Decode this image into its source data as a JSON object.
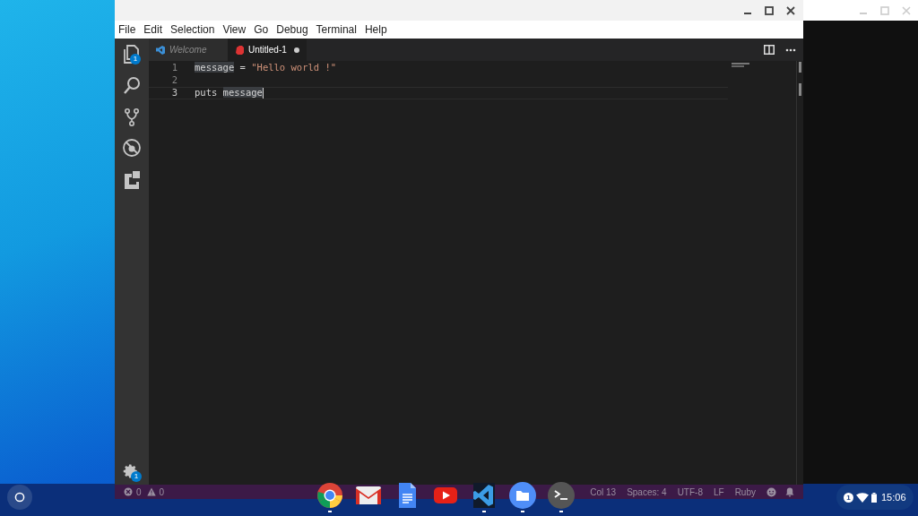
{
  "menu": [
    "File",
    "Edit",
    "Selection",
    "View",
    "Go",
    "Debug",
    "Terminal",
    "Help"
  ],
  "activity_bar": [
    {
      "kind": "files",
      "badge": "1"
    },
    {
      "kind": "search"
    },
    {
      "kind": "git"
    },
    {
      "kind": "debug"
    },
    {
      "kind": "extensions"
    }
  ],
  "settings_badge": "1",
  "tabs": [
    {
      "label": "Welcome",
      "selected": false,
      "kind": "welcome",
      "dirty": false
    },
    {
      "label": "Untitled-1",
      "selected": true,
      "kind": "ruby",
      "dirty": true
    }
  ],
  "lines": [
    {
      "number": "1",
      "current": false,
      "tokens": [
        {
          "text": "message",
          "kind": "plain",
          "highlight": true
        },
        {
          "text": " = ",
          "kind": "plain",
          "highlight": false
        },
        {
          "text": "\"Hello world !\"",
          "kind": "string",
          "highlight": false
        }
      ]
    },
    {
      "number": "2",
      "current": false
    },
    {
      "number": "3",
      "current": true,
      "tokens": [
        {
          "text": "puts ",
          "kind": "plain",
          "highlight": false
        },
        {
          "text": "message",
          "kind": "plain",
          "highlight": true
        }
      ]
    }
  ],
  "status_left": [
    {
      "kind": "error",
      "text": "0"
    },
    {
      "kind": "warning",
      "text": "0"
    }
  ],
  "status_right": [
    "Col 13",
    "Spaces: 4",
    "UTF-8",
    "LF",
    "Ruby"
  ],
  "shelf_apps": [
    {
      "kind": "chrome",
      "running": true
    },
    {
      "kind": "gmail",
      "running": false
    },
    {
      "kind": "docs",
      "running": false
    },
    {
      "kind": "youtube",
      "running": false
    },
    {
      "kind": "vscode",
      "running": true
    },
    {
      "kind": "files",
      "running": true
    },
    {
      "kind": "terminal",
      "running": true
    }
  ],
  "tray": {
    "notifications": "1",
    "time": "15:06"
  }
}
